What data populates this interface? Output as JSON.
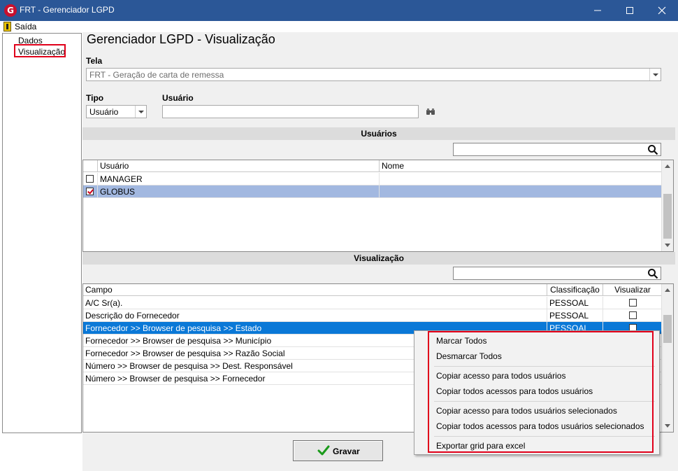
{
  "window": {
    "title": "FRT - Gerenciador LGPD",
    "icon": "app-logo-icon",
    "title_bar_color": "#2b5797"
  },
  "menu": {
    "exit_label": "Saída",
    "exit_icon": "exit-door-icon"
  },
  "nav": {
    "items": [
      {
        "label": "Dados"
      },
      {
        "label": "Visualização"
      }
    ],
    "selected": "Visualização"
  },
  "page": {
    "title": "Gerenciador LGPD - Visualização"
  },
  "form": {
    "tela_label": "Tela",
    "tela_value": "FRT - Geração de carta de remessa",
    "tipo_label": "Tipo",
    "tipo_value": "Usuário",
    "usuario_label": "Usuário",
    "usuario_value": "",
    "search_icon": "binoculars-icon"
  },
  "usuarios": {
    "section_title": "Usuários",
    "search_value": "",
    "columns": [
      "Usuário",
      "Nome"
    ],
    "rows": [
      {
        "usuario": "MANAGER",
        "nome": "",
        "checked": false
      },
      {
        "usuario": "GLOBUS",
        "nome": "",
        "checked": true
      }
    ]
  },
  "visualizacao": {
    "section_title": "Visualização",
    "search_value": "",
    "columns": [
      "Campo",
      "Classificação",
      "Visualizar"
    ],
    "rows": [
      {
        "campo": "A/C Sr(a).",
        "classificacao": "PESSOAL",
        "visualizar": false
      },
      {
        "campo": "Descrição do Fornecedor",
        "classificacao": "PESSOAL",
        "visualizar": false
      },
      {
        "campo": "Fornecedor >> Browser de pesquisa >> Estado",
        "classificacao": "PESSOAL",
        "visualizar": false
      },
      {
        "campo": "Fornecedor >> Browser de pesquisa >> Município",
        "classificacao": "",
        "visualizar": false
      },
      {
        "campo": "Fornecedor >> Browser de pesquisa >> Razão Social",
        "classificacao": "",
        "visualizar": false
      },
      {
        "campo": "Número >> Browser de pesquisa >> Dest. Responsável",
        "classificacao": "",
        "visualizar": false
      },
      {
        "campo": "Número >> Browser de pesquisa >> Fornecedor",
        "classificacao": "",
        "visualizar": false
      }
    ]
  },
  "context_menu": {
    "items": [
      "Marcar Todos",
      "Desmarcar Todos",
      "Copiar acesso para todos usuários",
      "Copiar todos acessos para todos usuários",
      "Copiar acesso para todos usuários selecionados",
      "Copiar todos acessos para todos usuários selecionados",
      "Exportar grid para excel"
    ]
  },
  "actions": {
    "save_label": "Gravar",
    "save_icon": "checkmark-icon"
  },
  "colors": {
    "highlight_border": "#e0001a",
    "row_selected": "#0a78d7",
    "row_checked": "#a2b8e0"
  }
}
